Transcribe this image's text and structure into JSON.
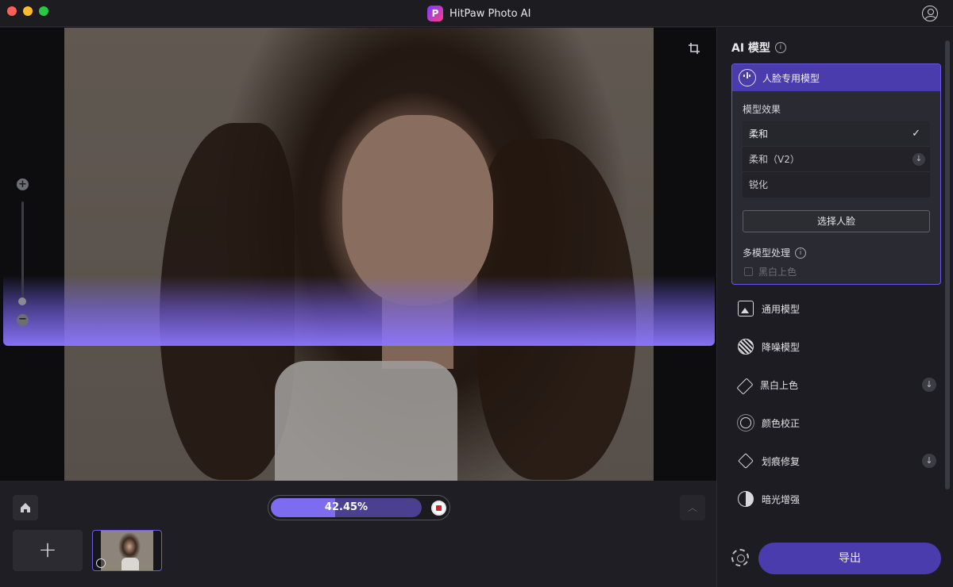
{
  "app": {
    "title": "HitPaw Photo AI",
    "logo_letter": "P"
  },
  "canvas": {
    "scan_color": "#8c76ff"
  },
  "bottom": {
    "progress_text": "42.45%",
    "progress_value": 42.45,
    "add_label": "+"
  },
  "panel": {
    "title": "AI 模型",
    "face_model": {
      "label": "人脸专用模型",
      "effect_label": "模型效果",
      "effects": [
        {
          "label": "柔和",
          "state": "selected"
        },
        {
          "label": "柔和（V2）",
          "state": "download"
        },
        {
          "label": "锐化",
          "state": ""
        }
      ],
      "select_face_label": "选择人脸",
      "multi_label": "多模型处理",
      "multi_option": "黑白上色"
    },
    "models": [
      {
        "label": "通用模型",
        "icon": "image-icon",
        "download": false
      },
      {
        "label": "降噪模型",
        "icon": "denoise-icon",
        "download": false
      },
      {
        "label": "黑白上色",
        "icon": "colorize-icon",
        "download": true
      },
      {
        "label": "颜色校正",
        "icon": "color-correct-icon",
        "download": false
      },
      {
        "label": "划痕修复",
        "icon": "scratch-repair-icon",
        "download": true
      },
      {
        "label": "暗光增强",
        "icon": "low-light-icon",
        "download": false
      }
    ],
    "export_label": "导出"
  },
  "colors": {
    "accent": "#4b3cad",
    "accent_light": "#7d6cf0",
    "record_red": "#e0202c"
  }
}
